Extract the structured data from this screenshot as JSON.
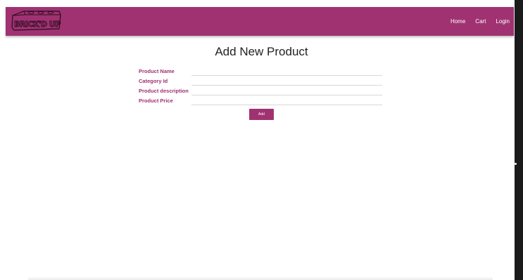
{
  "header": {
    "logo_text": "BRICK'D UP",
    "nav": [
      {
        "label": "Home"
      },
      {
        "label": "Cart"
      },
      {
        "label": "Login"
      }
    ]
  },
  "main": {
    "title": "Add New Product",
    "fields": [
      {
        "label": "Product Name",
        "value": "",
        "placeholder": ""
      },
      {
        "label": "Category Id",
        "value": "",
        "placeholder": ""
      },
      {
        "label": "Product description",
        "value": "",
        "placeholder": ""
      },
      {
        "label": "Product Price",
        "value": "",
        "placeholder": ""
      }
    ],
    "add_label": "Add"
  },
  "colors": {
    "brand": "#a03272",
    "background": "#ffffff"
  }
}
